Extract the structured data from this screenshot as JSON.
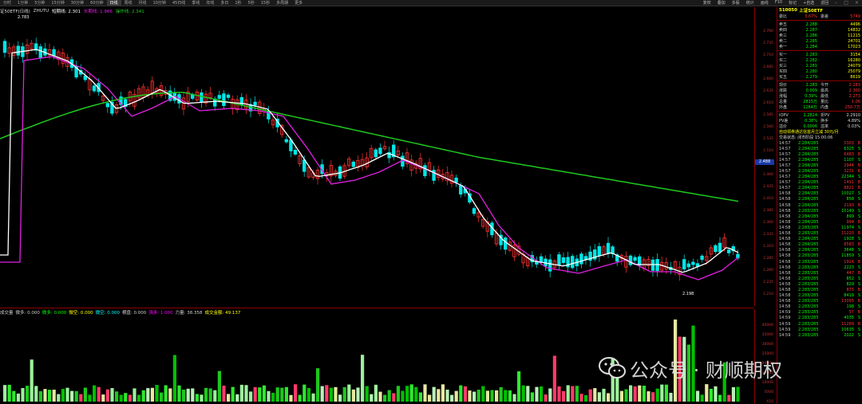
{
  "toolbar": {
    "periods": [
      "分时",
      "1分钟",
      "5分钟",
      "15分钟",
      "30分钟",
      "60分钟",
      "日线",
      "周线",
      "月线",
      "10分钟",
      "45日线",
      "季线",
      "年线",
      "多日",
      "1秒",
      "5秒",
      "15秒",
      "多周期",
      "更多"
    ],
    "active_period": "日线",
    "right_items": [
      "复权",
      "叠加",
      "多股",
      "统计",
      "画线",
      "F10",
      "标记",
      "+自选",
      "返回"
    ]
  },
  "infobar": {
    "symbol": "证50ETF(日线)",
    "indicator": "ZHUTU",
    "ma1": "短期线: 2.301",
    "ma2": "长期线: 1.966",
    "ma3": "操作线: 2.341"
  },
  "chart": {
    "y_ticks": [
      "2.760",
      "2.735",
      "2.710",
      "2.685",
      "2.660",
      "2.635",
      "2.610",
      "2.585",
      "2.560",
      "2.535",
      "2.510",
      "2.485",
      "2.460",
      "2.435",
      "2.410",
      "2.385",
      "2.360",
      "2.335",
      "2.310",
      "2.285",
      "2.260",
      "2.235",
      "2.210"
    ],
    "current_price": "2.488",
    "high_label": "2.783",
    "low_label": "2.198",
    "colors": {
      "up": "#ff3232",
      "down": "#00e6e6",
      "ma_short": "#ffffff",
      "ma_mid": "#e020e0",
      "ma_long": "#1ec81e"
    }
  },
  "volume": {
    "label_parts": [
      {
        "t": "成交量",
        "c": "#ccc"
      },
      {
        "t": "微多: 0.000",
        "c": "#ccc"
      },
      {
        "t": "微多: 0.000",
        "c": "#0f0"
      },
      {
        "t": "微空: 0.000",
        "c": "#ff0"
      },
      {
        "t": "微空: 0.000",
        "c": "#0ff"
      },
      {
        "t": "横盘: 0.000",
        "c": "#ccc"
      },
      {
        "t": "强多: 1.000",
        "c": "#f0f"
      },
      {
        "t": "力量: 38.358",
        "c": "#ccc"
      },
      {
        "t": "成交金额: 49.137",
        "c": "#ff0"
      }
    ],
    "axis_ticks": [
      "40000",
      "35000",
      "30000",
      "25000",
      "20000",
      "15000",
      "10000",
      "5000",
      "X10"
    ]
  },
  "quote_panel": {
    "code": "510050",
    "name": "上证50ETF",
    "header_extra": [
      "委比",
      "3.67%",
      "委差",
      "5749"
    ],
    "asks": [
      {
        "label": "卖五",
        "price": "2.288",
        "vol": "4496"
      },
      {
        "label": "卖四",
        "price": "2.287",
        "vol": "14832"
      },
      {
        "label": "卖三",
        "price": "2.286",
        "vol": "11215"
      },
      {
        "label": "卖二",
        "price": "2.285",
        "vol": "24701"
      },
      {
        "label": "卖一",
        "price": "2.284",
        "vol": "17023"
      }
    ],
    "bids": [
      {
        "label": "买一",
        "price": "2.283",
        "vol": "3154"
      },
      {
        "label": "买二",
        "price": "2.282",
        "vol": "16280"
      },
      {
        "label": "买三",
        "price": "2.281",
        "vol": "24079"
      },
      {
        "label": "买四",
        "price": "2.280",
        "vol": "25079"
      },
      {
        "label": "买五",
        "price": "2.279",
        "vol": "8619"
      }
    ],
    "stats": [
      [
        "现价",
        "2.283",
        "今开",
        "2.283"
      ],
      [
        "涨跌",
        "0.009",
        "最高",
        "2.300"
      ],
      [
        "涨幅",
        "0.39%",
        "最低",
        "2.273"
      ],
      [
        "总量",
        "2815万",
        "量比",
        "1.06"
      ],
      [
        "外盘",
        "1264万",
        "内盘",
        "250.7万"
      ]
    ],
    "iopv": [
      [
        "IOPV",
        "2.2824",
        "折PV",
        "2.2910"
      ],
      [
        "PV差",
        "0.38%",
        "换手",
        "4.89%"
      ],
      [
        "溢价",
        "0.0006",
        "溢率",
        "0.03%"
      ]
    ],
    "notice1": "自动领券通达信首月立减 30元/月",
    "notice2": "交易状态: 闭市阶段 15:00:06",
    "ticks": [
      [
        "14:57",
        "2.284/285",
        "5303",
        "B"
      ],
      [
        "14:57",
        "2.284/285",
        "6325",
        "S"
      ],
      [
        "14:57",
        "2.284/285",
        "6483",
        "B"
      ],
      [
        "14:57",
        "2.284/285",
        "1107",
        "S"
      ],
      [
        "14:57",
        "2.284/285",
        "2944",
        "B"
      ],
      [
        "14:57",
        "2.284/285",
        "3231",
        "B"
      ],
      [
        "14:57",
        "2.284/285",
        "22344",
        "S"
      ],
      [
        "14:57",
        "2.284/285",
        "1411",
        "B"
      ],
      [
        "14:57",
        "2.284/285",
        "8821",
        "B"
      ],
      [
        "14:58",
        "2.284/285",
        "10027",
        "S"
      ],
      [
        "14:58",
        "2.284/285",
        "858",
        "S"
      ],
      [
        "14:58",
        "2.284/285",
        "2193",
        "B"
      ],
      [
        "14:58",
        "2.283/285",
        "10149",
        "S"
      ],
      [
        "14:58",
        "2.284/285",
        "899",
        "S"
      ],
      [
        "14:58",
        "2.284/285",
        "994",
        "B"
      ],
      [
        "14:58",
        "2.283/285",
        "11974",
        "S"
      ],
      [
        "14:58",
        "2.283/285",
        "11220",
        "B"
      ],
      [
        "14:58",
        "2.284/285",
        "1928",
        "S"
      ],
      [
        "14:58",
        "2.284/285",
        "8583",
        "B"
      ],
      [
        "14:58",
        "2.284/285",
        "3648",
        "S"
      ],
      [
        "14:58",
        "2.283/285",
        "11859",
        "S"
      ],
      [
        "14:58",
        "2.283/285",
        "1924",
        "B"
      ],
      [
        "14:58",
        "2.283/285",
        "2223",
        "S"
      ],
      [
        "14:58",
        "2.283/285",
        "447",
        "B"
      ],
      [
        "14:58",
        "2.283/285",
        "852",
        "S"
      ],
      [
        "14:58",
        "2.283/285",
        "829",
        "S"
      ],
      [
        "14:58",
        "2.283/285",
        "875",
        "B"
      ],
      [
        "14:58",
        "2.283/285",
        "8419",
        "S"
      ],
      [
        "14:58",
        "2.283/285",
        "13095",
        "B"
      ],
      [
        "14:58",
        "2.283/285",
        "198",
        "S"
      ],
      [
        "14:59",
        "2.283/285",
        "57",
        "B"
      ],
      [
        "14:59",
        "2.283/285",
        "4035",
        "S"
      ],
      [
        "14:59",
        "2.283/285",
        "11289",
        "B"
      ],
      [
        "14:59",
        "2.283/285",
        "10635",
        "S"
      ],
      [
        "14:59",
        "2.283/285",
        "2022",
        "S"
      ]
    ]
  },
  "watermark": {
    "text": "公众号 · 财顺期权"
  }
}
